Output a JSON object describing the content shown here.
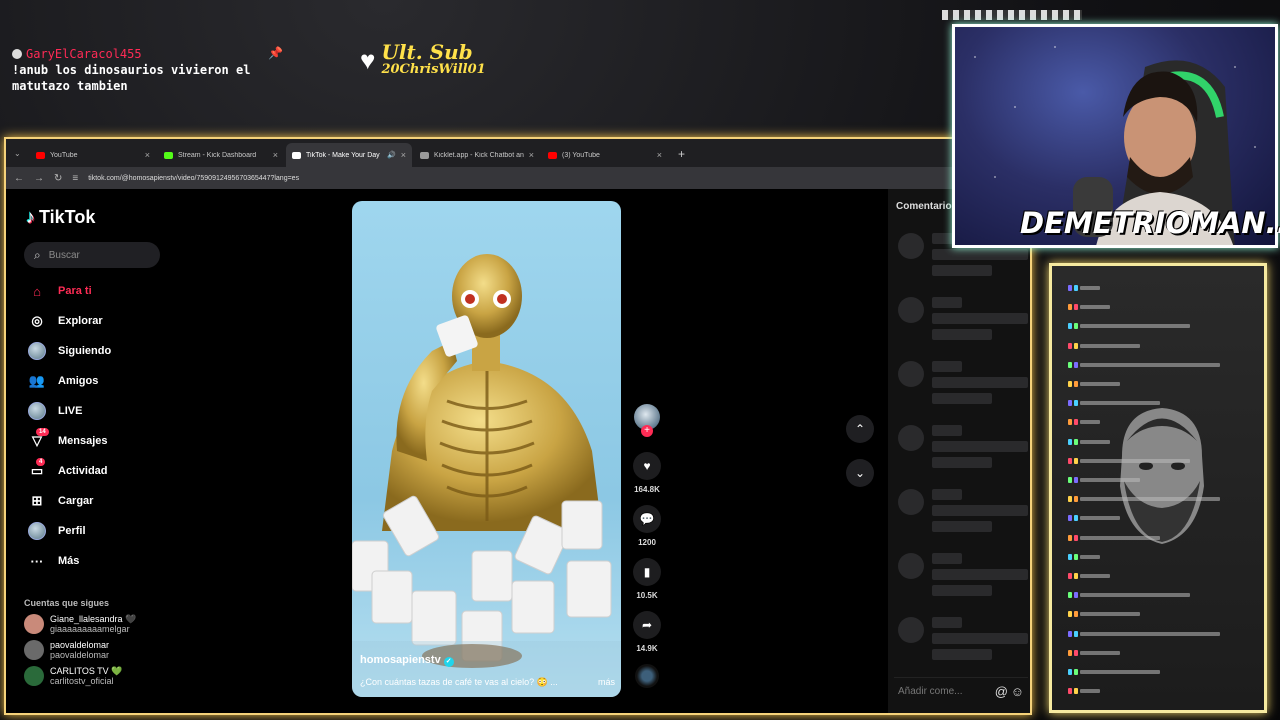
{
  "overlay": {
    "chat_user": "GaryElCaracol455",
    "chat_message": "!anub los dinosaurios vivieron el matutazo tambien",
    "sub_title": "Ult. Sub",
    "sub_name": "20ChrisWill01",
    "streamer_name": "DEMETRIOMAN..."
  },
  "browser": {
    "tabs": [
      {
        "label": "YouTube",
        "color": "#ff0000",
        "active": false
      },
      {
        "label": "Stream - Kick Dashboard",
        "color": "#53fc18",
        "active": false
      },
      {
        "label": "TikTok - Make Your Day",
        "color": "#ffffff",
        "active": true
      },
      {
        "label": "Kicklet.app - Kick Chatbot and",
        "color": "#9a9a9a",
        "active": false
      },
      {
        "label": "(3) YouTube",
        "color": "#ff0000",
        "active": false
      }
    ],
    "url": "tiktok.com/@homosapienstv/video/7590912495670365447?lang=es"
  },
  "tiktok": {
    "brand": "TikTok",
    "search_placeholder": "Buscar",
    "nav": [
      {
        "label": "Para ti",
        "icon": "home-icon",
        "active": true
      },
      {
        "label": "Explorar",
        "icon": "compass-icon"
      },
      {
        "label": "Siguiendo",
        "icon": "following-avatar-icon"
      },
      {
        "label": "Amigos",
        "icon": "friends-icon"
      },
      {
        "label": "LIVE",
        "icon": "live-icon"
      },
      {
        "label": "Mensajes",
        "icon": "messages-icon",
        "badge": "14"
      },
      {
        "label": "Actividad",
        "icon": "activity-icon",
        "badge": "4"
      },
      {
        "label": "Cargar",
        "icon": "upload-icon"
      },
      {
        "label": "Perfil",
        "icon": "profile-icon"
      },
      {
        "label": "Más",
        "icon": "more-icon"
      }
    ],
    "following_header": "Cuentas que sigues",
    "following": [
      {
        "name": "Giane_llalesandra 🖤",
        "handle": "giaaaaaaaaamelgar"
      },
      {
        "name": "paovaldelomar",
        "handle": "paovaldelomar"
      },
      {
        "name": "CARLITOS TV 💚",
        "handle": "carlitostv_oficial"
      }
    ],
    "video": {
      "author": "homosapienstv",
      "caption": "¿Con cuántas tazas de café te vas al cielo? 😳 ...",
      "more": "más"
    },
    "actions": {
      "likes": "164.8K",
      "comments": "1200",
      "saves": "10.5K",
      "shares": "14.9K"
    },
    "comments_title": "Comentarios",
    "comment_placeholder": "Añadir come..."
  },
  "colors": {
    "accent": "#fe2c55",
    "frame": "#f5d27a",
    "chat_frame": "#f6eaa0"
  }
}
